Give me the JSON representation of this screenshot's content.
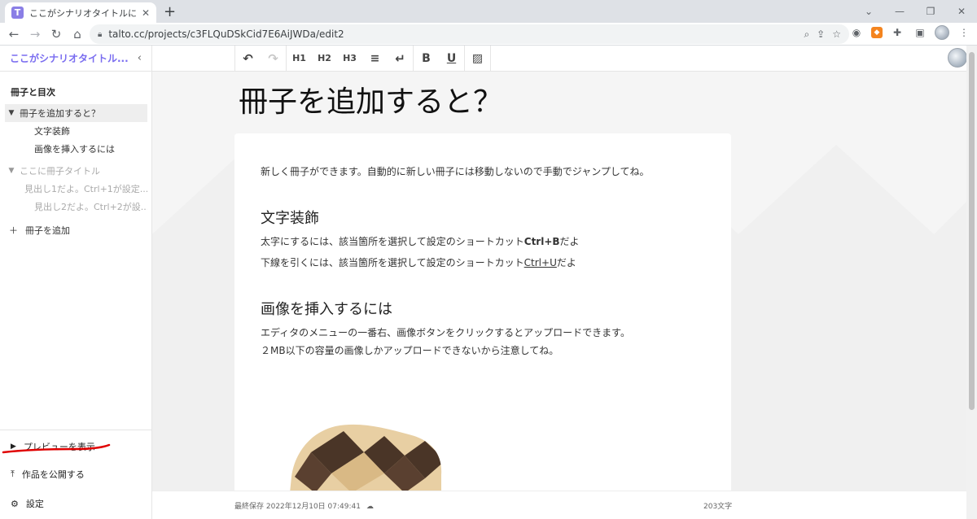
{
  "browser": {
    "tab_title": "ここがシナリオタイトルになります。- TA",
    "favicon_letter": "T",
    "url": "talto.cc/projects/c3FLQuDSkCid7E6AiJWDa/edit2",
    "new_tab": "+",
    "tab_close": "✕"
  },
  "sidebar": {
    "title": "ここがシナリオタイトル...",
    "toc_heading": "冊子と目次",
    "items": [
      {
        "label": "冊子を追加すると？",
        "level": 0,
        "active": true
      },
      {
        "label": "文字装飾",
        "level": 1
      },
      {
        "label": "画像を挿入するには",
        "level": 1
      },
      {
        "label": "ここに冊子タイトル",
        "level": 0,
        "dim": true
      },
      {
        "label": "見出し1だよ。Ctrl+1が設定...",
        "level": 0,
        "dim": true,
        "sub": true
      },
      {
        "label": "見出し2だよ。Ctrl+2が設...",
        "level": 1,
        "dim": true
      }
    ],
    "add_booklet": "冊子を追加",
    "preview": "プレビューを表示",
    "publish": "作品を公開する",
    "settings": "設定"
  },
  "editor_toolbar": {
    "h1": "H1",
    "h2": "H2",
    "h3": "H3",
    "bold": "B",
    "underline": "U"
  },
  "document": {
    "title": "冊子を追加すると？",
    "intro": "新しく冊子ができます。自動的に新しい冊子には移動しないので手動でジャンプしてね。",
    "section1_heading": "文字装飾",
    "bold_line_prefix": "太字にするには、該当箇所を選択して設定のショートカット",
    "bold_key": "Ctrl+B",
    "bold_line_suffix": "だよ",
    "underline_line_prefix": "下線を引くには、該当箇所を選択して設定のショートカット",
    "underline_key": "Ctrl+U",
    "underline_line_suffix": "だよ",
    "section2_heading": "画像を挿入するには",
    "image_line1": "エディタのメニューの一番右、画像ボタンをクリックするとアップロードできます。",
    "image_line2": "２MB以下の容量の画像しかアップロードできないから注意してね。"
  },
  "footer": {
    "last_saved": "最終保存 2022年12月10日 07:49:41",
    "char_count": "203文字"
  },
  "colors": {
    "accent": "#7a6df0",
    "annotation": "#e00000"
  }
}
